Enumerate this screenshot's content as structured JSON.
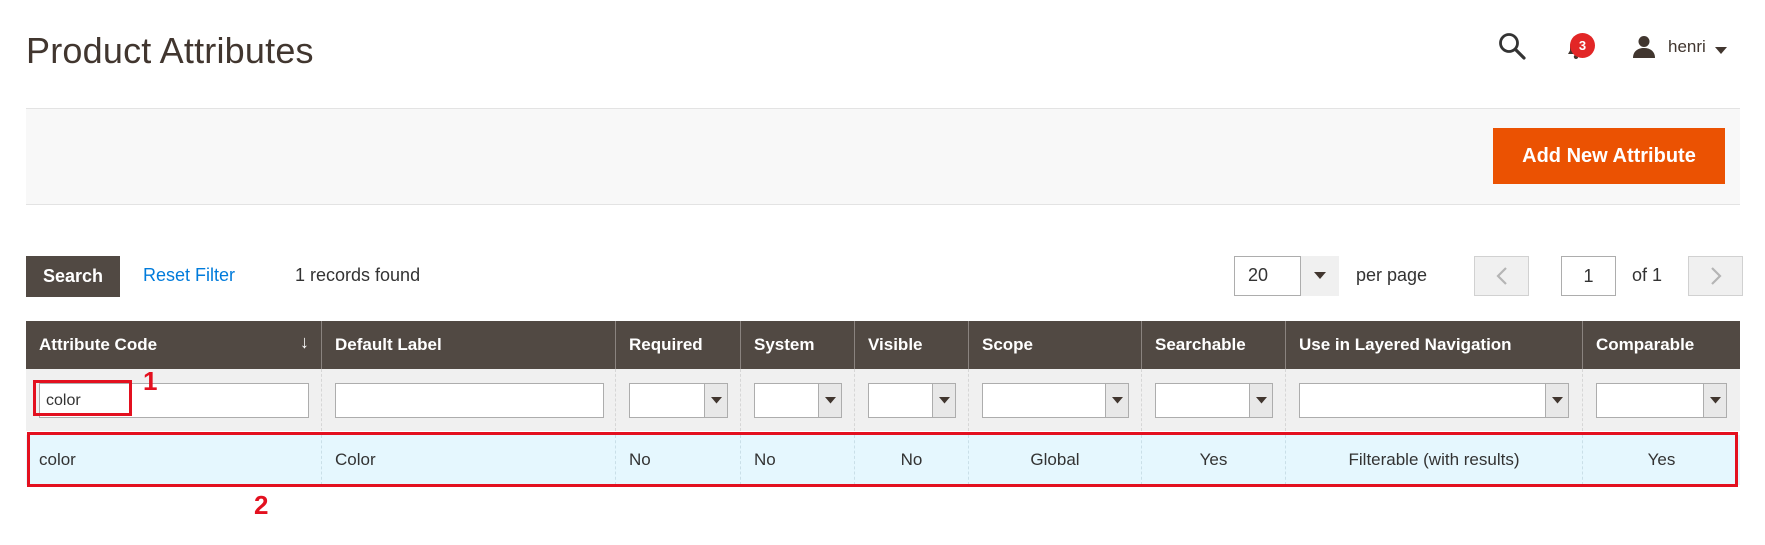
{
  "header": {
    "page_title": "Product Attributes",
    "notifications_count": "3",
    "user_name": "henri"
  },
  "actions": {
    "add_new_attribute": "Add New Attribute"
  },
  "toolbar": {
    "search_label": "Search",
    "reset_filter_label": "Reset Filter",
    "records_found": "1 records found",
    "per_page_value": "20",
    "per_page_label": "per page",
    "current_page": "1",
    "of_pages": "of 1"
  },
  "grid": {
    "columns": [
      "Attribute Code",
      "Default Label",
      "Required",
      "System",
      "Visible",
      "Scope",
      "Searchable",
      "Use in Layered Navigation",
      "Comparable"
    ],
    "filters": {
      "attribute_code": "color",
      "default_label": ""
    },
    "rows": [
      {
        "attribute_code": "color",
        "default_label": "Color",
        "required": "No",
        "system": "No",
        "visible": "No",
        "scope": "Global",
        "searchable": "Yes",
        "layered_navigation": "Filterable (with results)",
        "comparable": "Yes"
      }
    ]
  },
  "annotations": {
    "label_1": "1",
    "label_2": "2"
  },
  "colors": {
    "accent": "#eb5202",
    "header_dark": "#514943",
    "link": "#007bdb",
    "row_highlight": "#e5f7fe",
    "annotation": "#e3101f",
    "badge": "#e22626"
  }
}
